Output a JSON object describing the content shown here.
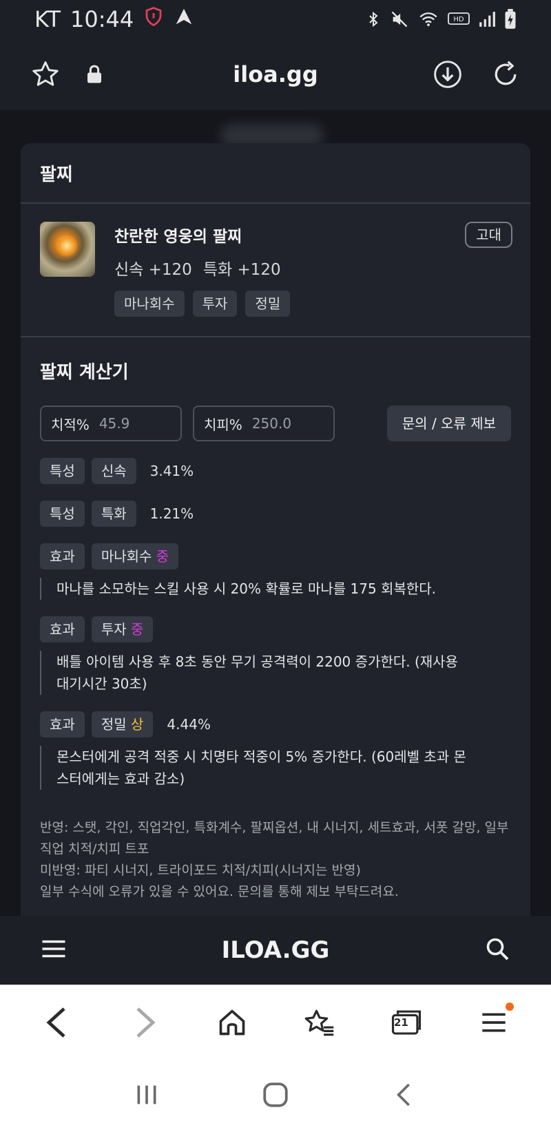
{
  "status_bar": {
    "carrier": "KT",
    "time": "10:44"
  },
  "browser": {
    "url": "iloa.gg"
  },
  "modal": {
    "title": "팔찌",
    "item": {
      "name": "찬란한 영웅의 팔찌",
      "stats": [
        "신속 +120",
        "특화 +120"
      ],
      "tags": [
        "마나회수",
        "투자",
        "정밀"
      ],
      "grade": "고대"
    },
    "calculator": {
      "title": "팔찌 계산기",
      "fields": [
        {
          "label": "치적%",
          "value": "45.9"
        },
        {
          "label": "치피%",
          "value": "250.0"
        }
      ],
      "report_button": "문의 / 오류 제보",
      "rows": [
        {
          "kind": "특성",
          "name": "신속",
          "percent": "3.41%"
        },
        {
          "kind": "특성",
          "name": "특화",
          "percent": "1.21%"
        },
        {
          "kind": "효과",
          "name": "마나회수",
          "level": "중",
          "description": "마나를 소모하는 스킬 사용 시 20% 확률로 마나를 175 회복한다."
        },
        {
          "kind": "효과",
          "name": "투자",
          "level": "중",
          "description": "배틀 아이템 사용 후 8초 동안 무기 공격력이 2200 증가한다. (재사용 대기시간 30초)"
        },
        {
          "kind": "효과",
          "name": "정밀",
          "level": "상",
          "percent": "4.44%",
          "description": "몬스터에게 공격 적중 시 치명타 적중이 5% 증가한다. (60레벨 초과 몬스터에게는 효과 감소)"
        }
      ],
      "notes": [
        "반영: 스탯, 각인, 직업각인, 특화계수, 팔찌옵션, 내 시너지, 세트효과, 서폿 갈망, 일부 직업 치적/치피 트포",
        "미반영: 파티 시너지, 트라이포드 치적/치피(시너지는 반영)",
        "일부 수식에 오류가 있을 수 있어요. 문의를 통해 제보 부탁드려요."
      ]
    }
  },
  "site_footer": {
    "logo": "ILOA.GG"
  },
  "browser_nav": {
    "tabs_count": "21"
  },
  "colors": {
    "level_mid": "#d43bd9",
    "level_high": "#f0c23c",
    "notif": "#f06a1a"
  }
}
